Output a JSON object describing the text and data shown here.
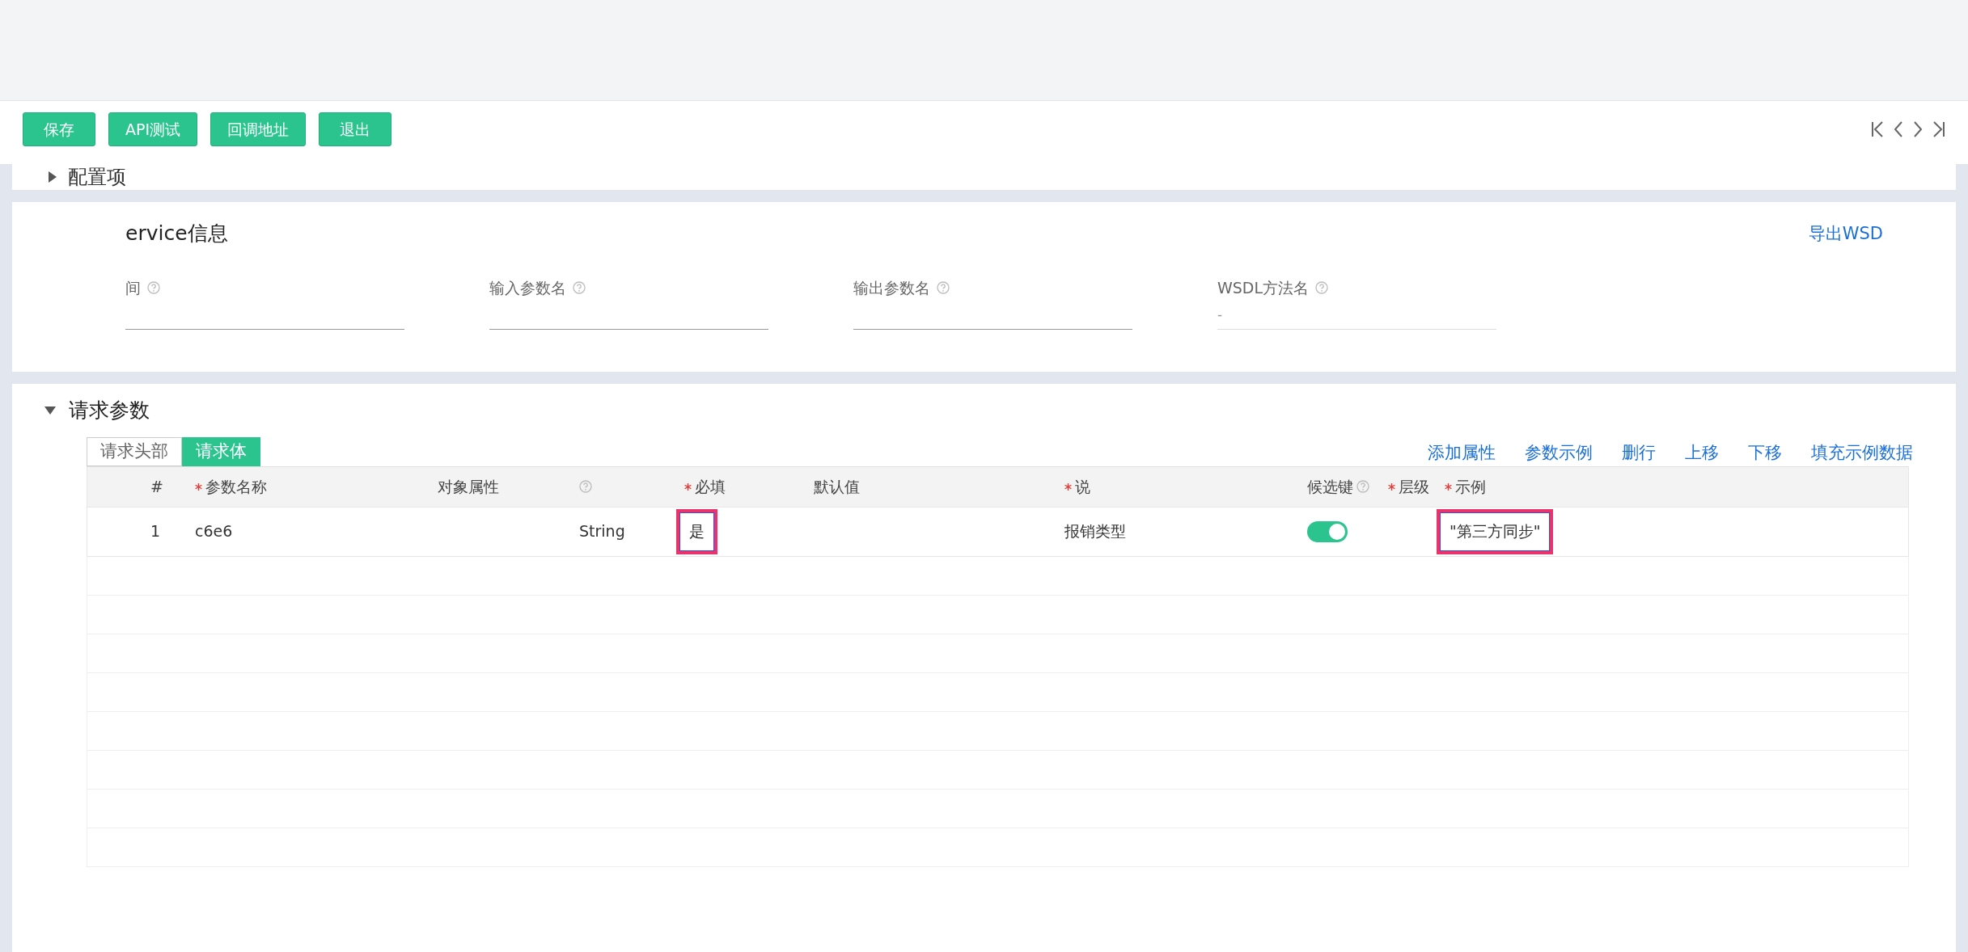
{
  "toolbar": {
    "buttons": [
      "保存",
      "API测试",
      "回调地址",
      "退出"
    ]
  },
  "config_section": {
    "title": "配置项",
    "expanded": false
  },
  "webservice": {
    "title": "ervice信息",
    "export_link": "导出WSD",
    "fields": [
      {
        "label": "间"
      },
      {
        "label": "输入参数名"
      },
      {
        "label": "输出参数名"
      },
      {
        "label": "WSDL方法名",
        "value": "-"
      }
    ]
  },
  "request_params": {
    "title": "请求参数",
    "expanded": true,
    "tabs": [
      {
        "label": "请求头部",
        "selected": false
      },
      {
        "label": "请求体",
        "selected": true
      }
    ],
    "actions": [
      "添加属性",
      "参数示例",
      "删行",
      "上移",
      "下移",
      "填充示例数据"
    ],
    "columns": [
      {
        "label": "#",
        "required": false,
        "help": false
      },
      {
        "label": "参数名称",
        "required": true,
        "help": false
      },
      {
        "label": "对象属性",
        "required": false,
        "help": false
      },
      {
        "required": false,
        "help": true
      },
      {
        "label": "必填",
        "required": true,
        "help": false
      },
      {
        "label": "默认值",
        "required": false,
        "help": false
      },
      {
        "label": "说",
        "required": true,
        "help": false
      },
      {
        "label": "候选键",
        "required": false,
        "help": true
      },
      {
        "label": "层级",
        "required": true,
        "help": false
      },
      {
        "label": "示例",
        "required": true,
        "help": false
      }
    ],
    "rows": [
      {
        "cells": [
          {
            "kind": "text",
            "text": "1",
            "highlighted": false
          },
          {
            "kind": "text",
            "text": "c6e6",
            "highlighted": false
          },
          {
            "kind": "text",
            "highlighted": false
          },
          {
            "kind": "text",
            "text": "String",
            "highlighted": false
          },
          {
            "kind": "text",
            "text": "是",
            "highlighted": true
          },
          {
            "kind": "text",
            "highlighted": false
          },
          {
            "kind": "text",
            "text": "报销类型",
            "highlighted": false
          },
          {
            "kind": "toggle",
            "on": true
          },
          {
            "kind": "text",
            "highlighted": false
          },
          {
            "kind": "text",
            "text": "\"第三方同步\"",
            "highlighted": true
          }
        ]
      }
    ]
  }
}
